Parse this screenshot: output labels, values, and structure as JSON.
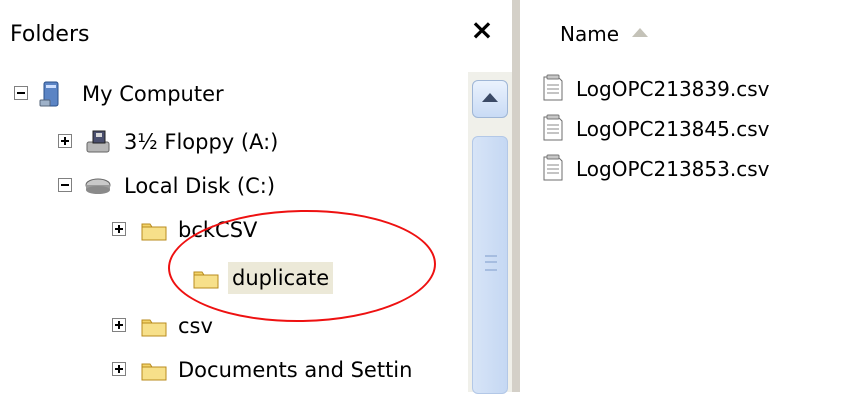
{
  "folders_pane": {
    "title": "Folders",
    "close_label": "×",
    "tree": [
      {
        "label": "My Computer",
        "icon": "computer-icon",
        "expander": "minus"
      },
      {
        "label": "3½ Floppy (A:)",
        "icon": "floppy-drive-icon",
        "expander": "plus"
      },
      {
        "label": "Local Disk (C:)",
        "icon": "hard-disk-icon",
        "expander": "minus"
      },
      {
        "label": "bckCSV",
        "icon": "folder-icon",
        "expander": "plus"
      },
      {
        "label": "duplicate",
        "icon": "folder-icon",
        "expander": "none",
        "selected": true
      },
      {
        "label": "csv",
        "icon": "folder-icon",
        "expander": "plus"
      },
      {
        "label": "Documents and Settin",
        "icon": "folder-icon",
        "expander": "plus"
      }
    ]
  },
  "files_pane": {
    "column_header": "Name",
    "sort_direction": "ascending",
    "files": [
      {
        "name": "LogOPC213839.csv",
        "icon": "text-file-icon"
      },
      {
        "name": "LogOPC213845.csv",
        "icon": "text-file-icon"
      },
      {
        "name": "LogOPC213853.csv",
        "icon": "text-file-icon"
      }
    ]
  },
  "annotation": {
    "type": "ellipse",
    "color": "#e11111",
    "target": "duplicate"
  },
  "colors": {
    "folder": "#f3d46b",
    "selection": "#ece9d8",
    "scroll_accent": "#c5d8f3"
  }
}
